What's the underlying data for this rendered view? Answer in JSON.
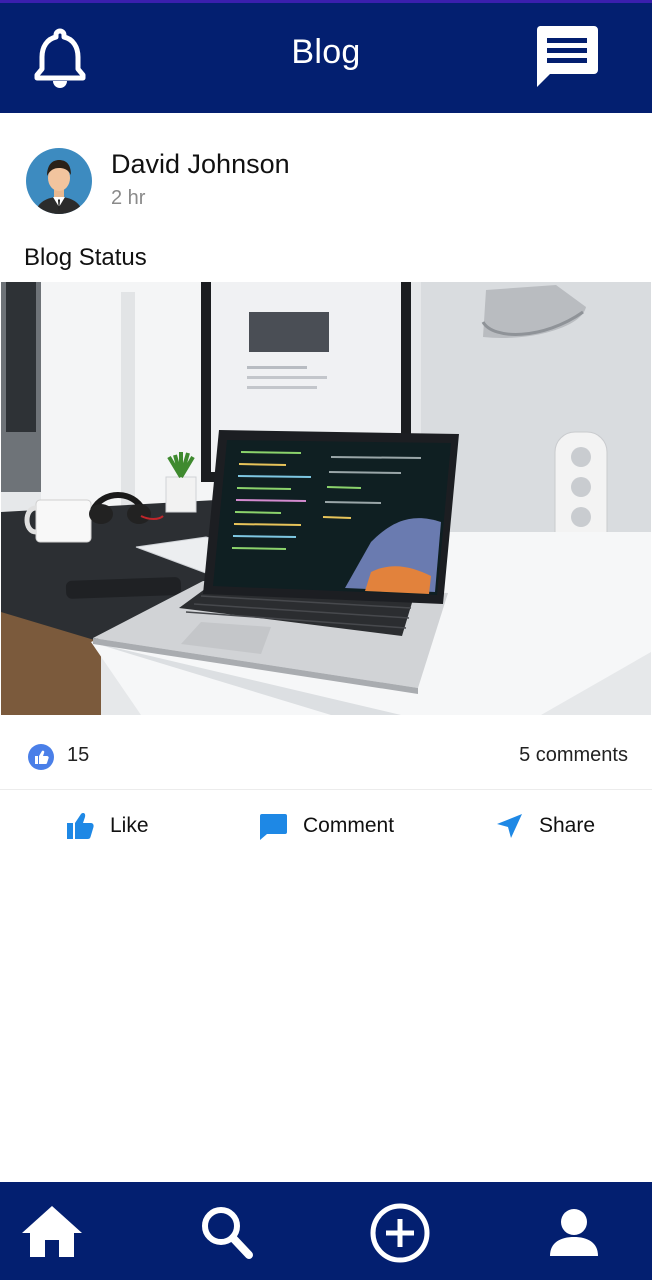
{
  "header": {
    "title": "Blog",
    "bell_icon": "bell-icon",
    "messages_icon": "chat-icon",
    "background": "#031f70"
  },
  "post": {
    "author": "David Johnson",
    "time": "2 hr",
    "status": "Blog Status",
    "image_icon": "laptop-desk-photo",
    "likes": "15",
    "comments": "5 comments"
  },
  "actions": {
    "like_label": "Like",
    "comment_label": "Comment",
    "share_label": "Share",
    "accent": "#1e88e5"
  },
  "bottom_nav": {
    "items": [
      {
        "icon": "home-icon"
      },
      {
        "icon": "search-icon"
      },
      {
        "icon": "add-circle-icon"
      },
      {
        "icon": "profile-icon"
      }
    ]
  }
}
